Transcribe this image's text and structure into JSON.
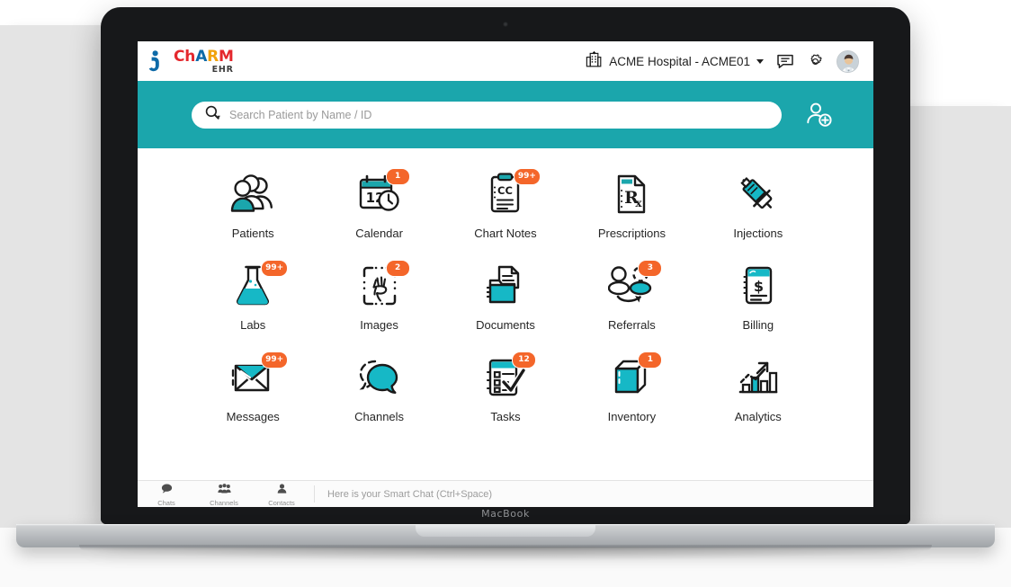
{
  "device": {
    "brand_label": "MacBook"
  },
  "app": {
    "logo": {
      "part1": "Ch",
      "part2": "A",
      "part3": "R",
      "part4": "M",
      "subtitle": "EHR",
      "color_red": "#e4282d",
      "color_blue": "#0e6aa8",
      "color_yellow": "#f2a20c"
    },
    "header": {
      "facility": "ACME Hospital - ACME01",
      "facility_caret": "chevron-down-icon",
      "chat_icon": "chat-bubble-icon",
      "settings_icon": "gear-icon",
      "avatar_icon": "doctor-avatar"
    },
    "search": {
      "placeholder": "Search Patient by Name / ID",
      "value": "",
      "search_icon": "search-icon",
      "add_patient_icon": "add-patient-icon",
      "band_color": "#1ba6ac"
    },
    "apps": [
      {
        "label": "Patients",
        "icon": "patients-icon",
        "badge": null
      },
      {
        "label": "Calendar",
        "icon": "calendar-icon",
        "badge": "1"
      },
      {
        "label": "Chart Notes",
        "icon": "chart-notes-icon",
        "badge": "99+"
      },
      {
        "label": "Prescriptions",
        "icon": "prescriptions-icon",
        "badge": null
      },
      {
        "label": "Injections",
        "icon": "injections-icon",
        "badge": null
      },
      {
        "label": "Labs",
        "icon": "labs-icon",
        "badge": "99+"
      },
      {
        "label": "Images",
        "icon": "images-icon",
        "badge": "2"
      },
      {
        "label": "Documents",
        "icon": "documents-icon",
        "badge": null
      },
      {
        "label": "Referrals",
        "icon": "referrals-icon",
        "badge": "3"
      },
      {
        "label": "Billing",
        "icon": "billing-icon",
        "badge": null
      },
      {
        "label": "Messages",
        "icon": "messages-icon",
        "badge": "99+"
      },
      {
        "label": "Channels",
        "icon": "channels-icon",
        "badge": null
      },
      {
        "label": "Tasks",
        "icon": "tasks-icon",
        "badge": "12"
      },
      {
        "label": "Inventory",
        "icon": "inventory-icon",
        "badge": "1"
      },
      {
        "label": "Analytics",
        "icon": "analytics-icon",
        "badge": null
      }
    ],
    "chatbar": {
      "tabs": [
        {
          "label": "Chats",
          "icon": "chat-bubble-icon"
        },
        {
          "label": "Channels",
          "icon": "channels-group-icon"
        },
        {
          "label": "Contacts",
          "icon": "contact-person-icon"
        }
      ],
      "smart_chat_placeholder": "Here is your Smart Chat (Ctrl+Space)",
      "smart_chat_value": ""
    },
    "badge_color": "#f4662a",
    "accent_color": "#1ba6ac"
  }
}
